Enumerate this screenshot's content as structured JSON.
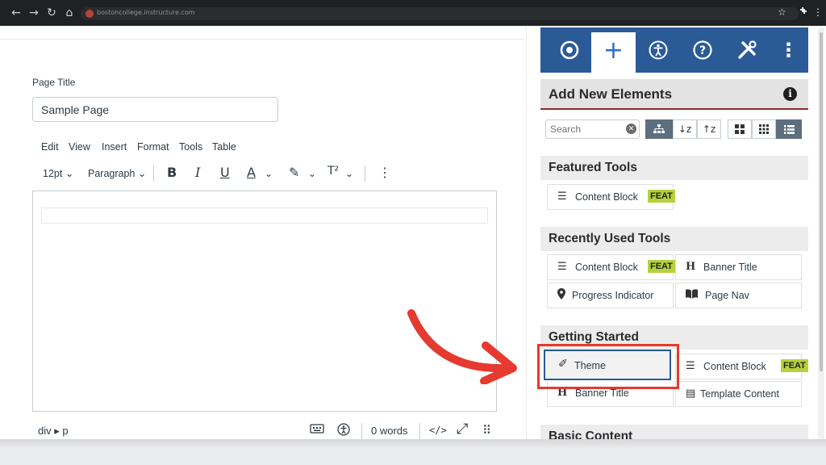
{
  "browser": {
    "url": "bostoncollege.instructure.com",
    "nav": {
      "back": "←",
      "forward": "→",
      "reload": "↻",
      "home": "⌂"
    },
    "star": "☆",
    "extensions_icon": "puzzle-icon",
    "menu_icon": "⋮"
  },
  "editor": {
    "page_title_label": "Page Title",
    "page_title_value": "Sample Page",
    "menubar": [
      "Edit",
      "View",
      "Insert",
      "Format",
      "Tools",
      "Table"
    ],
    "font_size": "12pt",
    "block_format": "Paragraph",
    "icons": {
      "bold": "B",
      "italic": "I",
      "underline": "U",
      "text_color": "A",
      "highlight": "✎",
      "superscript": "T²",
      "more": "⋮",
      "chevron": "⌄"
    },
    "status": {
      "path": "div ▸ p",
      "word_count": "0 words",
      "html_toggle": "</>",
      "expand": "⤢",
      "drag": "⠿"
    }
  },
  "panel": {
    "tabs": [
      {
        "name": "target-icon",
        "glyph": "◎"
      },
      {
        "name": "plus-icon",
        "glyph": "+"
      },
      {
        "name": "accessibility-icon",
        "glyph": "♿"
      },
      {
        "name": "help-icon",
        "glyph": "?"
      },
      {
        "name": "tools-icon",
        "glyph": "✖"
      },
      {
        "name": "more-icon",
        "glyph": "⋮"
      }
    ],
    "header": "Add New Elements",
    "info": "i",
    "search_placeholder": "Search",
    "clear": "✕",
    "view_buttons": [
      "⊞",
      "↓z",
      "↑z",
      "▦",
      "▦",
      "☰"
    ],
    "featured_title": "Featured Tools",
    "featured": [
      {
        "label": "Content Block",
        "badge": "FEAT",
        "icon": "☰"
      }
    ],
    "recent_title": "Recently Used Tools",
    "recent": [
      {
        "label": "Content Block",
        "badge": "FEAT",
        "icon": "☰"
      },
      {
        "label": "Banner Title",
        "icon": "H"
      },
      {
        "label": "Progress Indicator",
        "icon": "⚲"
      },
      {
        "label": "Page Nav",
        "icon": "▥"
      }
    ],
    "getting_started_title": "Getting Started",
    "getting_started": [
      {
        "label": "Theme",
        "icon": "✐"
      },
      {
        "label": "Content Block",
        "badge": "FEAT",
        "icon": "☰"
      },
      {
        "label": "Banner Title",
        "icon": "H"
      },
      {
        "label": "Template Content",
        "icon": "▤"
      }
    ],
    "basic_title": "Basic Content"
  },
  "colors": {
    "accent_blue": "#2a5b97",
    "feat_green": "#b5d13c",
    "annotation_red": "#e53a2f",
    "header_rule": "#8d2b30"
  }
}
